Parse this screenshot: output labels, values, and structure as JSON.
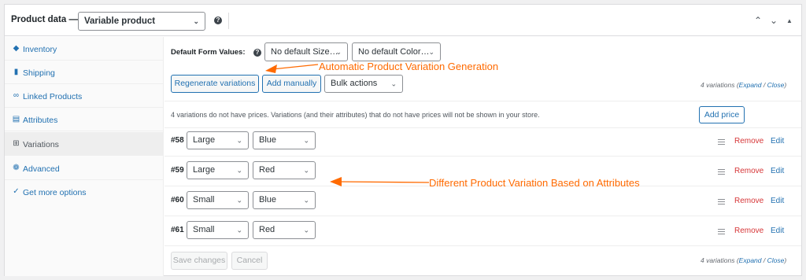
{
  "header": {
    "title": "Product data —",
    "product_type": "Variable product",
    "help_icon": "?"
  },
  "sidebar": {
    "items": [
      {
        "label": "Inventory",
        "icon": "tag-icon"
      },
      {
        "label": "Shipping",
        "icon": "truck-icon"
      },
      {
        "label": "Linked Products",
        "icon": "link-icon"
      },
      {
        "label": "Attributes",
        "icon": "list-icon"
      },
      {
        "label": "Variations",
        "icon": "grid-icon",
        "active": true
      },
      {
        "label": "Advanced",
        "icon": "gear-icon"
      },
      {
        "label": "Get more options",
        "icon": "plugin-icon"
      }
    ]
  },
  "defaults": {
    "label": "Default Form Values:",
    "size": "No default Size…",
    "color": "No default Color…"
  },
  "toolbar": {
    "regenerate": "Regenerate variations",
    "add_manually": "Add manually",
    "bulk": "Bulk actions",
    "count_text": "4 variations (",
    "expand": "Expand",
    "slash": " / ",
    "close": "Close",
    "close_paren": ")"
  },
  "notice": {
    "text": "4 variations do not have prices. Variations (and their attributes) that do not have prices will not be shown in your store.",
    "add_price": "Add price"
  },
  "variations": [
    {
      "id": "#58",
      "size": "Large",
      "color": "Blue",
      "remove": "Remove",
      "edit": "Edit"
    },
    {
      "id": "#59",
      "size": "Large",
      "color": "Red",
      "remove": "Remove",
      "edit": "Edit"
    },
    {
      "id": "#60",
      "size": "Small",
      "color": "Blue",
      "remove": "Remove",
      "edit": "Edit"
    },
    {
      "id": "#61",
      "size": "Small",
      "color": "Red",
      "remove": "Remove",
      "edit": "Edit"
    }
  ],
  "footer": {
    "save": "Save changes",
    "cancel": "Cancel"
  },
  "annotations": {
    "auto": "Automatic Product Variation Generation",
    "different": "Different Product Variation Based on Attributes",
    "color": "#ff6a00"
  }
}
